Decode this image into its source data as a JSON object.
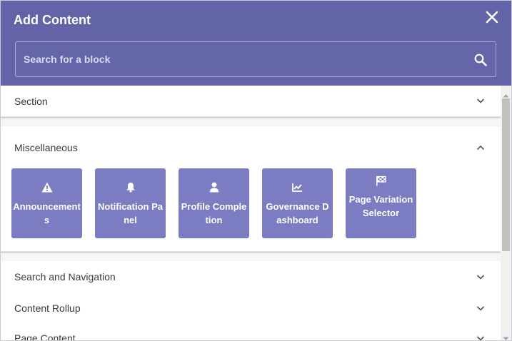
{
  "header": {
    "title": "Add Content"
  },
  "search": {
    "placeholder": "Search for a block",
    "value": ""
  },
  "sections": [
    {
      "label": "Section",
      "expanded": false
    },
    {
      "label": "Miscellaneous",
      "expanded": true,
      "tiles": [
        {
          "label": "Announcements",
          "icon": "warning-icon"
        },
        {
          "label": "Notification Panel",
          "icon": "bell-icon"
        },
        {
          "label": "Profile Completion",
          "icon": "user-icon"
        },
        {
          "label": "Governance Dashboard",
          "icon": "chart-line-icon"
        },
        {
          "label": "Page Variation Selector",
          "icon": "flag-checkered-icon"
        }
      ]
    },
    {
      "label": "Search and Navigation",
      "expanded": false
    },
    {
      "label": "Content Rollup",
      "expanded": false
    },
    {
      "label": "Page Content",
      "expanded": false
    }
  ],
  "colors": {
    "header": "#6264a7",
    "tile": "#7b7cc1",
    "text": "#3a3a3a"
  }
}
